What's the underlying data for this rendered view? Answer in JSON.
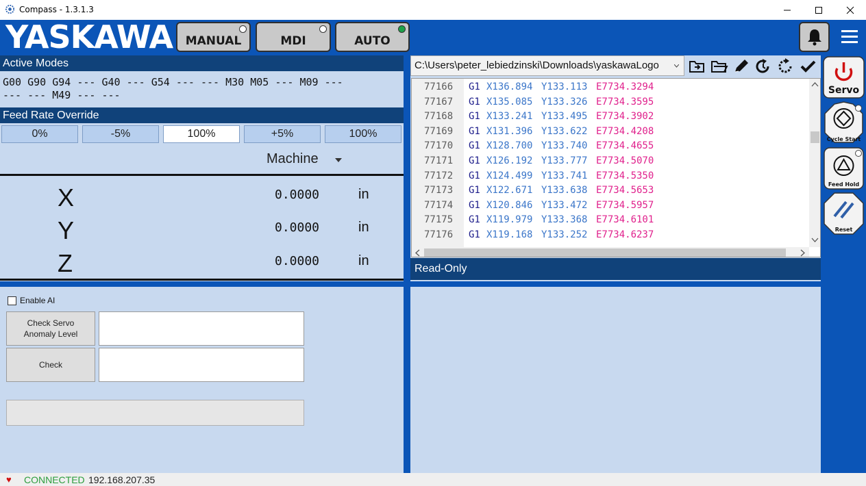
{
  "window": {
    "title": "Compass - 1.3.1.3",
    "icon": "compass-gear-icon"
  },
  "header": {
    "logo": "YASKAWA",
    "modes": [
      {
        "label": "MANUAL",
        "active": false
      },
      {
        "label": "MDI",
        "active": false
      },
      {
        "label": "AUTO",
        "active": true
      }
    ],
    "bell_icon": "bell-icon",
    "menu_icon": "hamburger-menu-icon"
  },
  "active_modes": {
    "title": "Active Modes",
    "text": "G00 G90 G94 --- G40 --- G54 --- --- M30 M05 --- M09 ---\n--- --- M49 --- ---"
  },
  "feed_rate": {
    "title": "Feed Rate Override",
    "buttons": [
      "0%",
      "-5%",
      "100%",
      "+5%",
      "100%"
    ],
    "active_index": 2
  },
  "position": {
    "coord_system": "Machine",
    "axes": [
      {
        "name": "X",
        "value": "0.0000",
        "unit": "in"
      },
      {
        "name": "Y",
        "value": "0.0000",
        "unit": "in"
      },
      {
        "name": "Z",
        "value": "0.0000",
        "unit": "in"
      }
    ]
  },
  "ai": {
    "enable_label": "Enable AI",
    "enabled": false,
    "check_servo_label_1": "Check Servo",
    "check_servo_label_2": "Anomaly Level",
    "check_label": "Check"
  },
  "program": {
    "path": "C:\\Users\\peter_lebiedzinski\\Downloads\\yaskawaLogo",
    "tools": [
      "open-folder-icon",
      "folder-icon",
      "pencil-icon",
      "reload-icon",
      "refresh-icon",
      "check-icon"
    ],
    "lines": [
      {
        "n": "77166",
        "g": "G1",
        "x": "X136.894",
        "y": "Y133.113",
        "e": "E7734.3294"
      },
      {
        "n": "77167",
        "g": "G1",
        "x": "X135.085",
        "y": "Y133.326",
        "e": "E7734.3595"
      },
      {
        "n": "77168",
        "g": "G1",
        "x": "X133.241",
        "y": "Y133.495",
        "e": "E7734.3902"
      },
      {
        "n": "77169",
        "g": "G1",
        "x": "X131.396",
        "y": "Y133.622",
        "e": "E7734.4208"
      },
      {
        "n": "77170",
        "g": "G1",
        "x": "X128.700",
        "y": "Y133.740",
        "e": "E7734.4655"
      },
      {
        "n": "77171",
        "g": "G1",
        "x": "X126.192",
        "y": "Y133.777",
        "e": "E7734.5070"
      },
      {
        "n": "77172",
        "g": "G1",
        "x": "X124.499",
        "y": "Y133.741",
        "e": "E7734.5350"
      },
      {
        "n": "77173",
        "g": "G1",
        "x": "X122.671",
        "y": "Y133.638",
        "e": "E7734.5653"
      },
      {
        "n": "77174",
        "g": "G1",
        "x": "X120.846",
        "y": "Y133.472",
        "e": "E7734.5957"
      },
      {
        "n": "77175",
        "g": "G1",
        "x": "X119.979",
        "y": "Y133.368",
        "e": "E7734.6101"
      },
      {
        "n": "77176",
        "g": "G1",
        "x": "X119.168",
        "y": "Y133.252",
        "e": "E7734.6237"
      }
    ],
    "mode_label": "Read-Only"
  },
  "side": {
    "servo_label": "Servo",
    "cycle_start_label": "Cycle Start",
    "feed_hold_label": "Feed Hold",
    "reset_label": "Reset"
  },
  "status": {
    "state": "CONNECTED",
    "ip": "192.168.207.35",
    "heart_icon": "heart-icon"
  },
  "colors": {
    "brand_blue": "#0b55b7",
    "header_navy": "#10427a",
    "panel": "#c8d9ef",
    "connected_green": "#2c9d3d",
    "servo_red": "#d01010"
  }
}
